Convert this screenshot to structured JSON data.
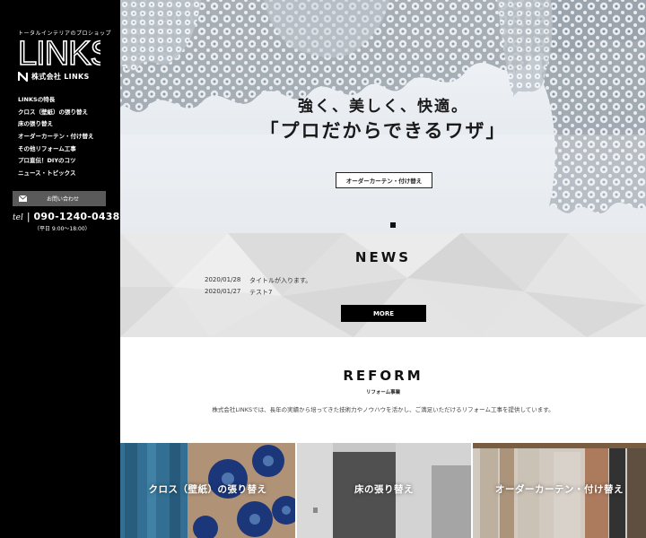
{
  "sidebar": {
    "tagline": "トータルインテリアのプロショップ",
    "logo_text": "LINKS",
    "company_name": "株式会社 LINKS",
    "nav": [
      {
        "label": "LINKSの特長"
      },
      {
        "label": "クロス（壁紙）の張り替え"
      },
      {
        "label": "床の張り替え"
      },
      {
        "label": "オーダーカーテン・付け替え"
      },
      {
        "label": "その他リフォーム工事"
      },
      {
        "label": "プロ直伝！DIYのコツ"
      },
      {
        "label": "ニュース・トピックス"
      }
    ],
    "contact_label": "お問い合わせ",
    "tel_label": "tel",
    "tel_separator": "|",
    "tel_number": "090-1240-0438",
    "hours": "（平日 9:00〜18:00）"
  },
  "hero": {
    "title": "強く、美しく、快適。",
    "subtitle": "「プロだからできるワザ」",
    "button_label": "オーダーカーテン・付け替え"
  },
  "news": {
    "title": "NEWS",
    "items": [
      {
        "date": "2020/01/28",
        "text": "タイトルが入ります。"
      },
      {
        "date": "2020/01/27",
        "text": "テスト7"
      }
    ],
    "more_label": "MORE"
  },
  "reform": {
    "title": "REFORM",
    "subtitle": "リフォーム事業",
    "description": "株式会社LINKSでは、長年の実績から培ってきた技術力やノウハウを活かし、ご満足いただけるリフォーム工事を提供しています。"
  },
  "services": [
    {
      "label": "クロス（壁紙）の張り替え"
    },
    {
      "label": "床の張り替え"
    },
    {
      "label": "オーダーカーテン・付け替え"
    }
  ],
  "colors": {
    "sidebar_bg": "#000000",
    "contact_bg": "#5a5a5a",
    "accent": "#000000"
  },
  "icons": [
    "mail-icon",
    "links-logo-n-icon"
  ]
}
